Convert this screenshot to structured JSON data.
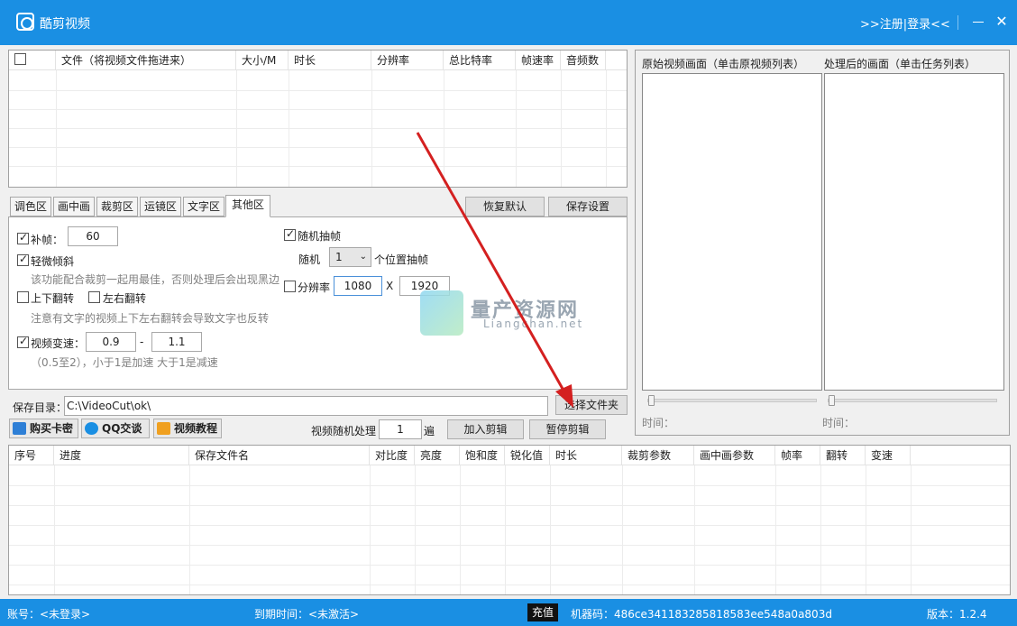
{
  "titlebar": {
    "title": "酷剪视频",
    "login": ">>注册|登录<<",
    "close": "✕"
  },
  "file_table": {
    "headers": [
      "文件（将视频文件拖进来）",
      "大小/M",
      "时长",
      "分辨率",
      "总比特率",
      "帧速率",
      "音频数"
    ]
  },
  "tabs": [
    "调色区",
    "画中画",
    "裁剪区",
    "运镜区",
    "文字区",
    "其他区"
  ],
  "active_tab": "其他区",
  "settings_buttons": {
    "reset": "恢复默认",
    "save": "保存设置"
  },
  "other_panel": {
    "fill_frame": {
      "label": "补帧：",
      "checked": true,
      "value": "60"
    },
    "slight_tilt": {
      "label": "轻微倾斜",
      "checked": true,
      "hint": "该功能配合裁剪一起用最佳，否则处理后会出现黑边"
    },
    "flip_v": {
      "label": "上下翻转",
      "checked": false
    },
    "flip_h": {
      "label": "左右翻转",
      "checked": false
    },
    "flip_hint": "注意有文字的视频上下左右翻转会导致文字也反转",
    "speed": {
      "label": "视频变速：",
      "checked": true,
      "min": "0.9",
      "sep": "-",
      "max": "1.1",
      "hint": "（0.5至2），小于1是加速 大于1是减速"
    },
    "random_drop": {
      "label": "随机抽帧",
      "checked": true,
      "prefix": "随机",
      "value": "1",
      "suffix": "个位置抽帧"
    },
    "resolution": {
      "label": "分辨率",
      "checked": false,
      "width": "1080",
      "x": "X",
      "height": "1920"
    }
  },
  "preview": {
    "original_label": "原始视频画面（单击原视频列表）",
    "processed_label": "处理后的画面（单击任务列表）",
    "time_label_1": "时间：",
    "time_label_2": "时间："
  },
  "save_dir": {
    "label": "保存目录：",
    "value": "C:\\VideoCut\\ok\\",
    "choose": "选择文件夹"
  },
  "action_buttons": {
    "buy": "购买卡密",
    "qq": "QQ交谈",
    "tutorial": "视频教程",
    "random_label": "视频随机处理",
    "random_count": "1",
    "random_unit": "遍",
    "add": "加入剪辑",
    "pause": "暂停剪辑"
  },
  "task_table": {
    "headers": [
      "序号",
      "进度",
      "保存文件名",
      "对比度",
      "亮度",
      "饱和度",
      "锐化值",
      "时长",
      "裁剪参数",
      "画中画参数",
      "帧率",
      "翻转",
      "变速"
    ]
  },
  "status": {
    "account": "账号：<未登录>",
    "expire": "到期时间：<未激活>",
    "recharge": "充值",
    "machine": "机器码：486ce341183285818583ee548a0a803d",
    "version": "版本：1.2.4"
  },
  "watermark": {
    "text": "量产资源网",
    "sub": "Liangchan.net"
  },
  "colors": {
    "titlebar": "#1a8fe3",
    "statusbar": "#1a8fe3",
    "arrow": "#d42020"
  }
}
